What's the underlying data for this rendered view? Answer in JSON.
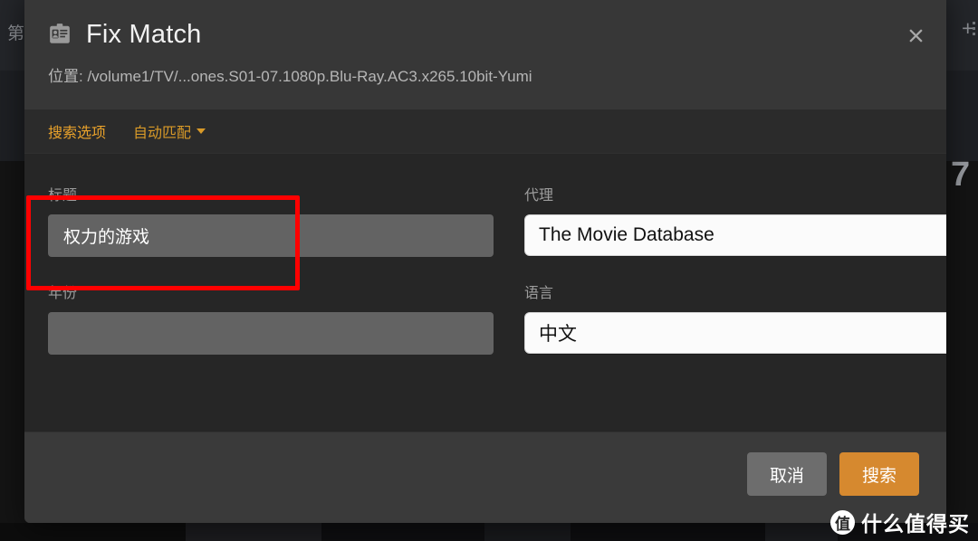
{
  "background": {
    "left_label": "第",
    "plus_icon": "plus-icon",
    "menu_dots_icon": "more-vertical-icon",
    "number_badge": "7",
    "strip_count": 7
  },
  "modal": {
    "icon": "id-badge-icon",
    "title": "Fix Match",
    "subtitle": "位置: /volume1/TV/...ones.S01-07.1080p.Blu-Ray.AC3.x265.10bit-Yumi",
    "close_icon": "close-icon",
    "tabs": [
      {
        "label": "搜索选项",
        "active": true,
        "has_caret": false
      },
      {
        "label": "自动匹配",
        "active": false,
        "has_caret": true
      }
    ],
    "fields": {
      "title": {
        "label": "标题",
        "value": "权力的游戏",
        "placeholder": ""
      },
      "year": {
        "label": "年份",
        "value": "",
        "placeholder": ""
      },
      "agent": {
        "label": "代理",
        "value": "The Movie Database",
        "options": [
          "The Movie Database"
        ]
      },
      "language": {
        "label": "语言",
        "value": "中文",
        "options": [
          "中文"
        ]
      }
    },
    "footer": {
      "cancel_label": "取消",
      "search_label": "搜索"
    }
  },
  "annotation": {
    "color": "#ff0000",
    "target": "title-field"
  },
  "watermark": {
    "logo_glyph": "值",
    "text": "什么值得买"
  },
  "colors": {
    "accent_orange": "#d6892f",
    "tab_orange": "#e9a22b",
    "modal_header_bg": "#373737",
    "modal_body_bg": "#262626",
    "modal_footer_bg": "#3a3a3a",
    "input_bg": "#636363",
    "annotation_red": "#ff0000"
  }
}
